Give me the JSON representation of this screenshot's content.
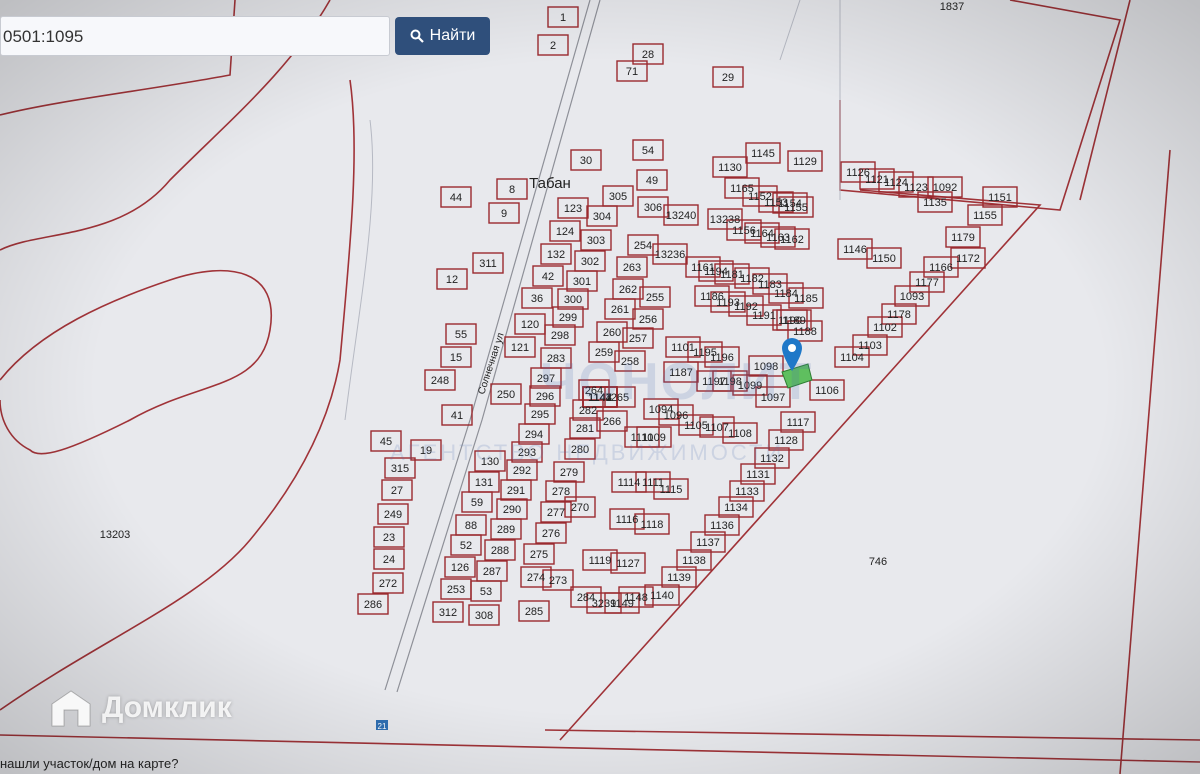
{
  "search": {
    "value": "0501:1095",
    "button_label": "Найти"
  },
  "map": {
    "village_label": "Табан",
    "street_label": "Солнечная ул",
    "route_badge": "21",
    "large_parcels": [
      "13203",
      "746",
      "1837"
    ],
    "selected_parcel": "1095",
    "parcels": [
      "1",
      "2",
      "28",
      "71",
      "29",
      "54",
      "30",
      "49",
      "8",
      "44",
      "9",
      "305",
      "306",
      "13240",
      "123",
      "304",
      "124",
      "303",
      "132",
      "302",
      "254",
      "13236",
      "311",
      "12",
      "42",
      "301",
      "263",
      "36",
      "300",
      "262",
      "255",
      "120",
      "299",
      "261",
      "256",
      "55",
      "121",
      "298",
      "260",
      "257",
      "15",
      "283",
      "259",
      "258",
      "248",
      "297",
      "264",
      "250",
      "296",
      "282",
      "265",
      "41",
      "295",
      "281",
      "266",
      "294",
      "280",
      "45",
      "19",
      "293",
      "279",
      "315",
      "130",
      "292",
      "278",
      "27",
      "131",
      "291",
      "277",
      "249",
      "59",
      "290",
      "276",
      "270",
      "88",
      "289",
      "23",
      "52",
      "288",
      "275",
      "273",
      "24",
      "126",
      "287",
      "274",
      "272",
      "253",
      "53",
      "286",
      "312",
      "308",
      "285",
      "284",
      "3239",
      "1149",
      "1148",
      "1145",
      "1129",
      "1130",
      "13238",
      "1165",
      "1152",
      "1153",
      "1154",
      "1155",
      "1156",
      "1164",
      "1163",
      "1162",
      "1161",
      "1194",
      "1181",
      "1182",
      "1183",
      "1184",
      "1185",
      "1186",
      "1193",
      "1192",
      "1191",
      "1190",
      "1189",
      "1188",
      "1187",
      "1101",
      "1195",
      "1196",
      "1197",
      "1198",
      "1099",
      "1098",
      "1097",
      "1094",
      "1096",
      "1105",
      "1107",
      "1108",
      "1109",
      "1110",
      "1114",
      "1111",
      "1115",
      "1116",
      "1118",
      "1119",
      "1127",
      "1126",
      "1121",
      "1124",
      "1123",
      "1092",
      "1135",
      "1146",
      "1150",
      "1151",
      "1155",
      "1179",
      "1172",
      "1166",
      "1177",
      "1093",
      "1178",
      "1102",
      "1103",
      "1104",
      "1106",
      "1117",
      "1128",
      "1132",
      "1131",
      "1133",
      "1134",
      "1136",
      "1137",
      "1138",
      "1139",
      "1140",
      "1141",
      "1142",
      "1143",
      "1144",
      "1147"
    ]
  },
  "watermark": {
    "brand": "Домклик",
    "overlay_brand": "ЧОНОЛИТ",
    "overlay_tagline": "АГЕНТСТВО НЕДВИЖИМОСТИ"
  },
  "footer": {
    "hint": "нашли участок/дом на карте?"
  },
  "colors": {
    "parcel_border": "#9b2a2f",
    "button_bg": "#2f4f7b",
    "pin": "#1f78c8",
    "selected_fill": "#5fbf5f"
  }
}
